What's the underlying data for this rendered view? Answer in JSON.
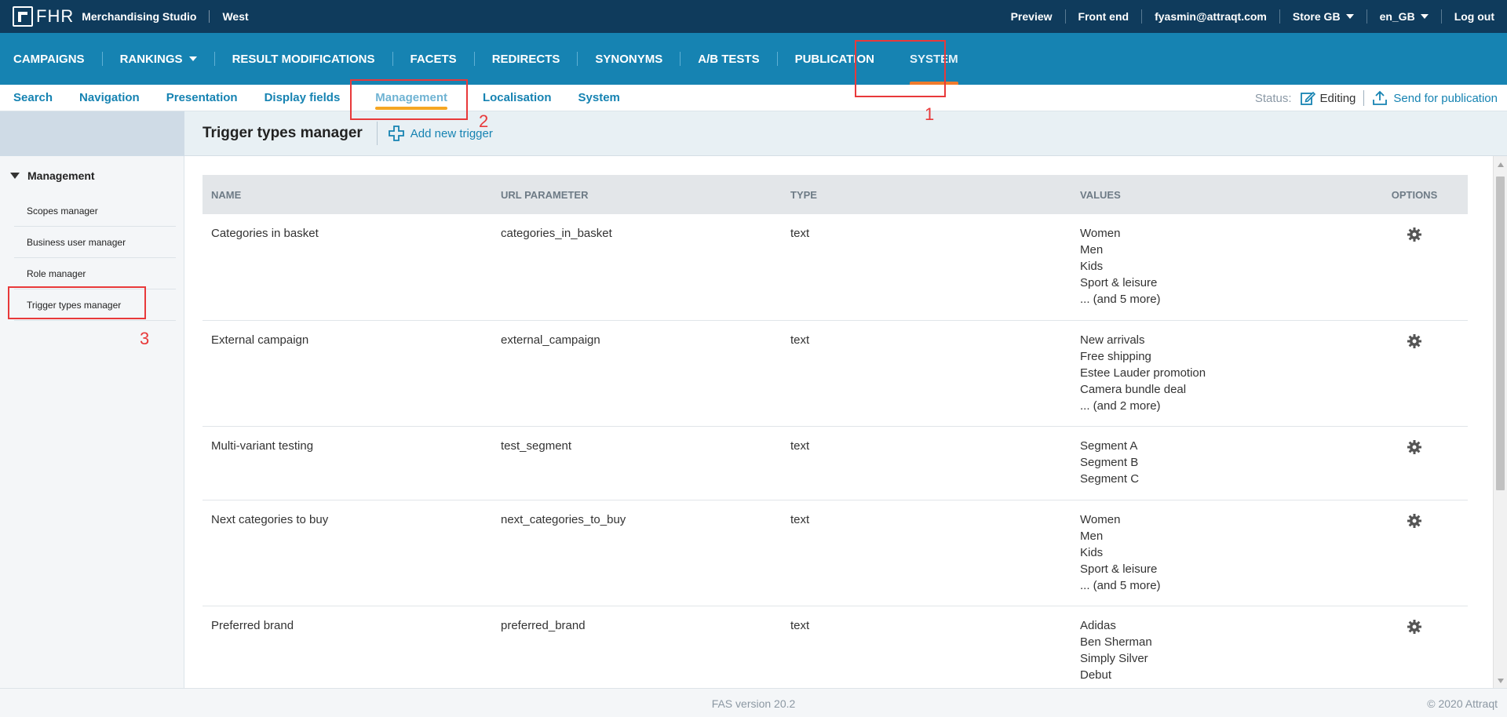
{
  "topbar": {
    "logo_text": "FHR",
    "studio": "Merchandising Studio",
    "region": "West",
    "links": {
      "preview": "Preview",
      "frontend": "Front end",
      "user": "fyasmin@attraqt.com",
      "store": "Store GB",
      "locale": "en_GB",
      "logout": "Log out"
    }
  },
  "mainnav": {
    "items": [
      "CAMPAIGNS",
      "RANKINGS",
      "RESULT MODIFICATIONS",
      "FACETS",
      "REDIRECTS",
      "SYNONYMS",
      "A/B TESTS",
      "PUBLICATION",
      "SYSTEM"
    ],
    "active": "SYSTEM"
  },
  "subnav": {
    "items": [
      "Search",
      "Navigation",
      "Presentation",
      "Display fields",
      "Management",
      "Localisation",
      "System"
    ],
    "active": "Management",
    "status_label": "Status:",
    "editing": "Editing",
    "send": "Send for publication"
  },
  "sidebar": {
    "section": "Management",
    "items": [
      "Scopes manager",
      "Business user manager",
      "Role manager",
      "Trigger types manager"
    ]
  },
  "content": {
    "title": "Trigger types manager",
    "add_label": "Add new trigger"
  },
  "table": {
    "headers": [
      "NAME",
      "URL PARAMETER",
      "TYPE",
      "VALUES",
      "OPTIONS"
    ],
    "rows": [
      {
        "name": "Categories in basket",
        "param": "categories_in_basket",
        "type": "text",
        "values": [
          "Women",
          "Men",
          "Kids",
          "Sport & leisure",
          "... (and 5 more)"
        ]
      },
      {
        "name": "External campaign",
        "param": "external_campaign",
        "type": "text",
        "values": [
          "New arrivals",
          "Free shipping",
          "Estee Lauder promotion",
          "Camera bundle deal",
          "... (and 2 more)"
        ]
      },
      {
        "name": "Multi-variant testing",
        "param": "test_segment",
        "type": "text",
        "values": [
          "Segment A",
          "Segment B",
          "Segment C"
        ]
      },
      {
        "name": "Next categories to buy",
        "param": "next_categories_to_buy",
        "type": "text",
        "values": [
          "Women",
          "Men",
          "Kids",
          "Sport & leisure",
          "... (and 5 more)"
        ]
      },
      {
        "name": "Preferred brand",
        "param": "preferred_brand",
        "type": "text",
        "values": [
          "Adidas",
          "Ben Sherman",
          "Simply Silver",
          "Debut"
        ]
      }
    ]
  },
  "footer": {
    "version": "FAS version 20.2",
    "copyright": "© 2020 Attraqt"
  },
  "annotations": [
    "1",
    "2",
    "3"
  ],
  "colors": {
    "topbar": "#0f3b5c",
    "mainnav": "#1683b2",
    "accent_orange": "#f07b2d",
    "annotation_red": "#e8393a"
  }
}
